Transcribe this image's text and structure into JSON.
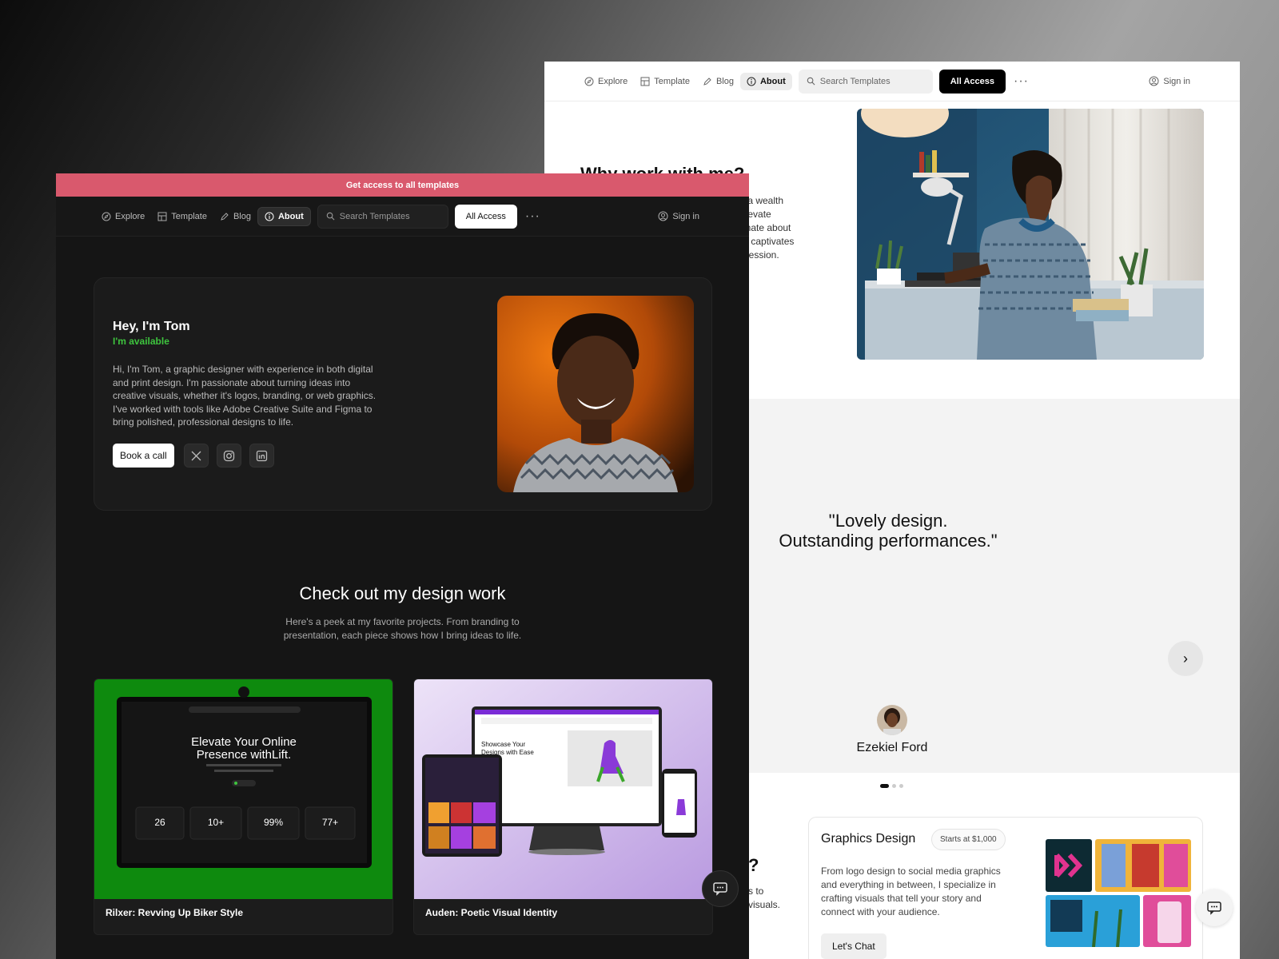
{
  "light": {
    "nav": {
      "explore": "Explore",
      "template": "Template",
      "blog": "Blog",
      "about": "About",
      "search_placeholder": "Search Templates",
      "all_access": "All Access",
      "more": "···",
      "sign_in": "Sign in"
    },
    "why_heading": "Why work with me?",
    "why_text_lines": [
      "k a wealth",
      "elevate",
      "onate about",
      "at captivates",
      "pression."
    ],
    "testimonial": {
      "quote_line1": "''Lovely design.",
      "quote_line2": "Outstanding performances.\"",
      "name": "Ezekiel Ford",
      "next": "›"
    },
    "services_heading_fragment": "?",
    "services_text_lines": [
      "s to",
      "visuals."
    ],
    "service_card": {
      "title": "Graphics Design",
      "price": "Starts at $1,000",
      "description": "From logo design to social media graphics and everything in between, I specialize in crafting visuals that tell your story and connect with your audience.",
      "button": "Let's Chat"
    }
  },
  "dark": {
    "banner": "Get access to all templates",
    "nav": {
      "explore": "Explore",
      "template": "Template",
      "blog": "Blog",
      "about": "About",
      "search_placeholder": "Search Templates",
      "all_access": "All Access",
      "more": "···",
      "sign_in": "Sign in"
    },
    "hero": {
      "greeting": "Hey, I'm Tom",
      "status": "I'm available",
      "bio": "Hi, I'm Tom, a graphic designer with experience in both digital and print design. I'm passionate about turning ideas into creative visuals, whether it's logos, branding, or web graphics. I've worked with tools like Adobe Creative Suite and Figma to bring polished, professional designs to life.",
      "book_call": "Book a call"
    },
    "work": {
      "heading": "Check out my design work",
      "subtitle_line1": "Here's a peek at my favorite projects. From branding to",
      "subtitle_line2": "presentation, each piece shows how I bring ideas to life.",
      "projects": [
        {
          "title": "Rilxer: Revving Up Biker Style",
          "mock_headline1": "Elevate Your Online",
          "mock_headline2": "Presence withLift.",
          "mock_stats": [
            "26",
            "10+",
            "99%",
            "77+"
          ]
        },
        {
          "title": "Auden: Poetic Visual Identity",
          "mock_headline1": "Showcase Your",
          "mock_headline2": "Designs with Ease"
        }
      ]
    }
  },
  "colors": {
    "banner": "#d9596d",
    "available": "#3ec43e",
    "project1_bg": "#0e8a0e",
    "project2_bg": "#d9c6f0"
  }
}
